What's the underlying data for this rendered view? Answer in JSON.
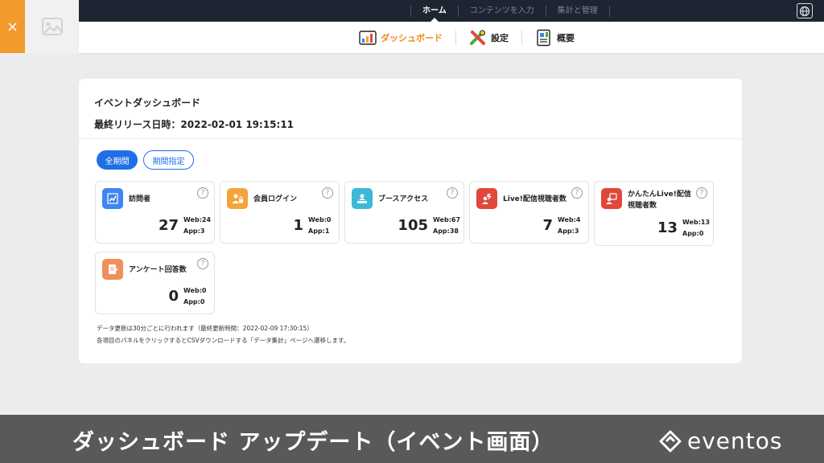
{
  "topnav": {
    "items": [
      {
        "label": "ホーム",
        "active": true
      },
      {
        "label": "コンテンツを入力",
        "active": false
      },
      {
        "label": "集計と管理",
        "active": false
      }
    ]
  },
  "close_label": "×",
  "subnav": {
    "items": [
      {
        "label": "ダッシュボード",
        "icon": "chart-board-icon",
        "active": true
      },
      {
        "label": "設定",
        "icon": "tools-icon",
        "active": false
      },
      {
        "label": "概要",
        "icon": "document-icon",
        "active": false
      }
    ]
  },
  "dashboard": {
    "title": "イベントダッシュボード",
    "release_label": "最終リリース日時：2022-02-01 19:15:11",
    "filters": {
      "all": "全期間",
      "range": "期間指定"
    },
    "panels": [
      {
        "name": "訪問者",
        "count": "27",
        "web": "Web:24",
        "app": "App:3",
        "icon": "trend-up-icon",
        "color": "#3f86f0"
      },
      {
        "name": "会員ログイン",
        "count": "1",
        "web": "Web:0",
        "app": "App:1",
        "icon": "member-lock-icon",
        "color": "#f3a43a"
      },
      {
        "name": "ブースアクセス",
        "count": "105",
        "web": "Web:67",
        "app": "App:38",
        "icon": "booth-icon",
        "color": "#3db9d7"
      },
      {
        "name": "Live!配信視聴者数",
        "count": "7",
        "web": "Web:4",
        "app": "App:3",
        "icon": "live-viewer-icon",
        "color": "#e0483a"
      },
      {
        "name": "かんたんLive!配信視聴者数",
        "count": "13",
        "web": "Web:13",
        "app": "App:0",
        "icon": "easy-live-icon",
        "color": "#e0483a"
      },
      {
        "name": "アンケート回答数",
        "count": "0",
        "web": "Web:0",
        "app": "App:0",
        "icon": "survey-icon",
        "color": "#ef8f5a"
      }
    ],
    "help_glyph": "?",
    "note1": "データ更新は30分ごとに行われます（最終更新時間：2022-02-09 17:30:15）",
    "note2": "各項目のパネルをクリックするとCSVダウンロードする「データ集計」ページへ遷移します。"
  },
  "banner": {
    "text": "ダッシュボード アップデート（イベント画面）",
    "logo_text": "eventos"
  }
}
